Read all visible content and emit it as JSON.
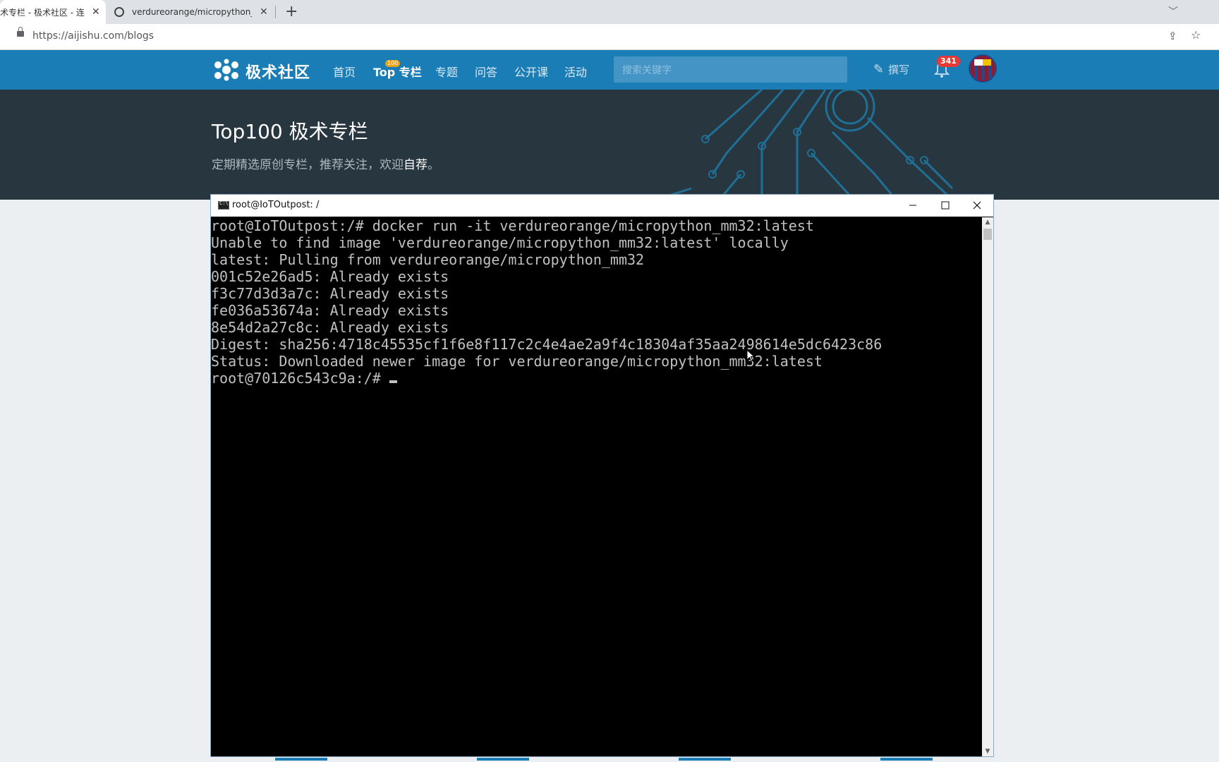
{
  "browser": {
    "tabs": [
      {
        "title": "术专栏 - 极术社区 - 连"
      },
      {
        "title": "verdureorange/micropython_r"
      }
    ],
    "new_tab": "+",
    "url": "https://aijishu.com/blogs"
  },
  "site": {
    "logo_text": "极术社区",
    "nav": [
      {
        "label": "首页"
      },
      {
        "label": "Top 专栏",
        "badge": "100"
      },
      {
        "label": "专题"
      },
      {
        "label": "问答"
      },
      {
        "label": "公开课"
      },
      {
        "label": "活动"
      }
    ],
    "search_placeholder": "搜索关键字",
    "write_label": "撰写",
    "notification_count": "341"
  },
  "banner": {
    "title": "Top100 极术专栏",
    "subtitle_prefix": "定期精选原创专栏，推荐关注，欢迎",
    "subtitle_link": "自荐",
    "subtitle_suffix": "。"
  },
  "terminal": {
    "title": "root@IoTOutpost: /",
    "lines": [
      "root@IoTOutpost:/# docker run -it verdureorange/micropython_mm32:latest",
      "Unable to find image 'verdureorange/micropython_mm32:latest' locally",
      "latest: Pulling from verdureorange/micropython_mm32",
      "001c52e26ad5: Already exists",
      "f3c77d3d3a7c: Already exists",
      "fe036a53674a: Already exists",
      "8e54d2a27c8c: Already exists",
      "Digest: sha256:4718c45535cf1f6e8f117c2c4e4ae2a9f4c18304af35aa2498614e5dc6423c86",
      "Status: Downloaded newer image for verdureorange/micropython_mm32:latest"
    ],
    "prompt": "root@70126c543c9a:/# "
  },
  "colors": {
    "nav_bg": "#1b7db5",
    "banner_bg": "#28363f",
    "terminal_bg": "#000000",
    "terminal_fg": "#c0c0c0",
    "badge_red": "#e53935"
  }
}
